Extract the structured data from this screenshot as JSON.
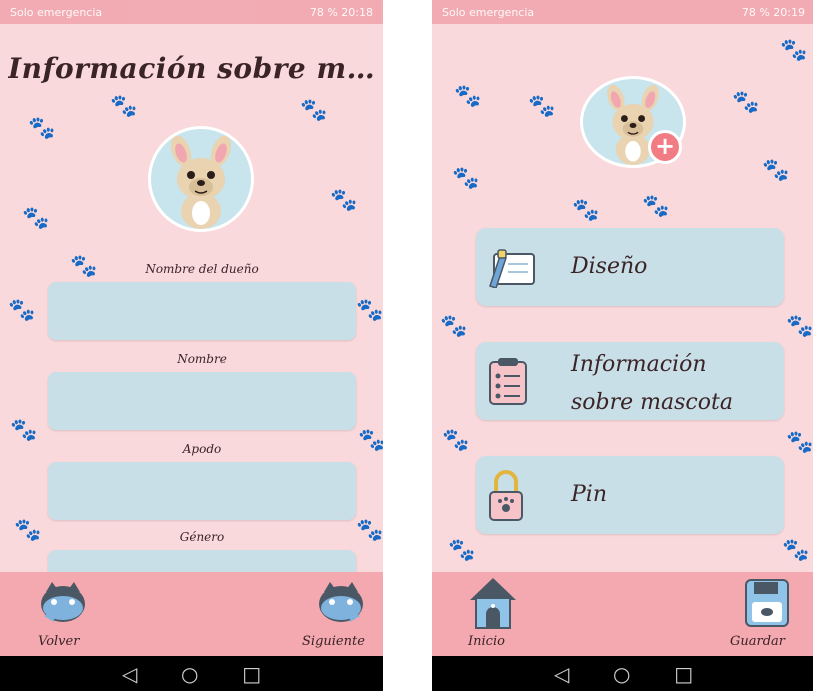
{
  "left_screen": {
    "status_left": "Solo emergencia",
    "status_right": "78 % 20:18",
    "title": "Información sobre ma…",
    "fields": [
      {
        "label": "Nombre del dueño",
        "value": ""
      },
      {
        "label": "Nombre",
        "value": ""
      },
      {
        "label": "Apodo",
        "value": ""
      },
      {
        "label": "Género",
        "value": ""
      }
    ],
    "back_label": "Volver",
    "next_label": "Siguiente"
  },
  "right_screen": {
    "status_left": "Solo emergencia",
    "status_right": "78 % 20:19",
    "menu": [
      {
        "label": "Diseño",
        "icon": "design-card-icon"
      },
      {
        "label_line1": "Información",
        "label_line2": "sobre mascota",
        "icon": "clipboard-icon"
      },
      {
        "label": "Pin",
        "icon": "padlock-icon"
      }
    ],
    "home_label": "Inicio",
    "save_label": "Guardar"
  },
  "colors": {
    "background": "#f9d9dc",
    "bar": "#f4a8b0",
    "input": "#c9dfe8",
    "accent": "#f27c83"
  }
}
